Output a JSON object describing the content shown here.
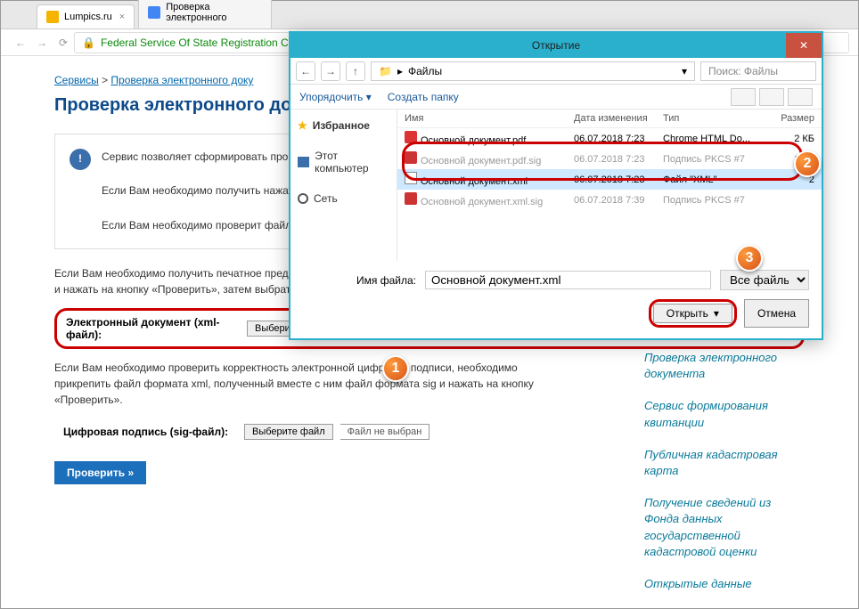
{
  "tabs": [
    {
      "title": "Lumpics.ru"
    },
    {
      "title": "Проверка электронного"
    }
  ],
  "url_text": "Federal Service Of State Registration Ca",
  "breadcrumb": {
    "home": "Сервисы",
    "sep": ">",
    "current": "Проверка электронного доку"
  },
  "page_title": "Проверка электронного докум",
  "info": {
    "p1": "Сервис позволяет сформировать проверить корректность электр",
    "p2": "Если Вам необходимо получить нажать на кнопку «Проверить»",
    "p3": "Если Вам необходимо проверит файл формата xml, полученный"
  },
  "paras": {
    "pa": "Если Вам необходимо получить печатное представление выписки, достаточно загрузить xml-файл и нажать на кнопку «Проверить», затем выбрать функцию «Показать файл».",
    "pb": "Если Вам необходимо проверить корректность электронной цифровой подписи, необходимо прикрепить файл формата xml, полученный вместе с ним файл формата sig и нажать на кнопку «Проверить»."
  },
  "fields": {
    "xml_label": "Электронный документ (xml-файл):",
    "sig_label": "Цифровая подпись (sig-файл):",
    "choose": "Выберите файл",
    "none": "Файл не выбран"
  },
  "submit": "Проверить »",
  "side_links": [
    "Проверка электронного документа",
    "Сервис формирования квитанции",
    "Публичная кадастровая карта",
    "Получение сведений из Фонда данных государственной кадастровой оценки",
    "Открытые данные"
  ],
  "dialog": {
    "title": "Открытие",
    "path": "Файлы",
    "search": "Поиск: Файлы",
    "organize": "Упорядочить ▾",
    "newfolder": "Создать папку",
    "side": {
      "fav": "Избранное",
      "pc": "Этот компьютер",
      "net": "Сеть"
    },
    "cols": {
      "name": "Имя",
      "date": "Дата изменения",
      "type": "Тип",
      "size": "Размер"
    },
    "files": [
      {
        "name": "Основной документ.pdf",
        "date": "06.07.2018 7:23",
        "type": "Chrome HTML Do...",
        "size": "2 КБ",
        "ico": "pdf"
      },
      {
        "name": "Основной документ.pdf.sig",
        "date": "06.07.2018 7:23",
        "type": "Подпись PKCS #7",
        "size": "2 КБ",
        "ico": "sig",
        "dim": true
      },
      {
        "name": "Основной документ.xml",
        "date": "06.07.2018 7:23",
        "type": "Файл \"XML\"",
        "size": "2",
        "ico": "xml",
        "selected": true
      },
      {
        "name": "Основной документ.xml.sig",
        "date": "06.07.2018 7:39",
        "type": "Подпись PKCS #7",
        "size": "",
        "ico": "sig",
        "dim": true
      }
    ],
    "fname_label": "Имя файла:",
    "fname_value": "Основной документ.xml",
    "filter": "Все файлы",
    "open": "Открыть",
    "cancel": "Отмена"
  },
  "badges": {
    "1": "1",
    "2": "2",
    "3": "3"
  }
}
